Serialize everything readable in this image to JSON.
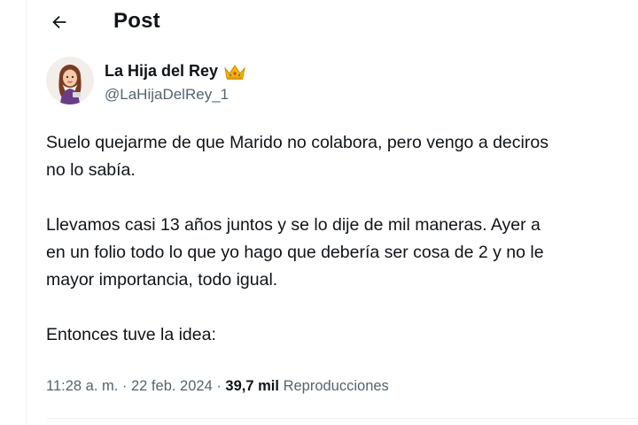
{
  "header": {
    "title": "Post",
    "back_icon": "arrow-left-icon"
  },
  "author": {
    "name": "La Hija del Rey",
    "handle": "@LaHijaDelRey_1",
    "badge_icon": "crown-icon"
  },
  "tweet": {
    "lines": [
      "Suelo quejarme de que Marido no colabora, pero vengo a deciros",
      "no lo sabía.",
      "",
      "Llevamos casi 13 años juntos y se lo dije de mil maneras. Ayer a",
      "en un folio todo lo que yo hago que debería ser cosa de 2 y no le",
      "mayor importancia, todo igual.",
      "",
      "Entonces tuve la idea:"
    ]
  },
  "meta": {
    "time": "11:28 a. m.",
    "sep1": " · ",
    "date": "22 feb. 2024",
    "sep2": " · ",
    "views_count": "39,7 mil",
    "views_label": "Reproducciones"
  },
  "colors": {
    "text": "#0f1419",
    "secondary": "#536471",
    "divider": "#eff3f4",
    "crown": "#f4b400"
  }
}
